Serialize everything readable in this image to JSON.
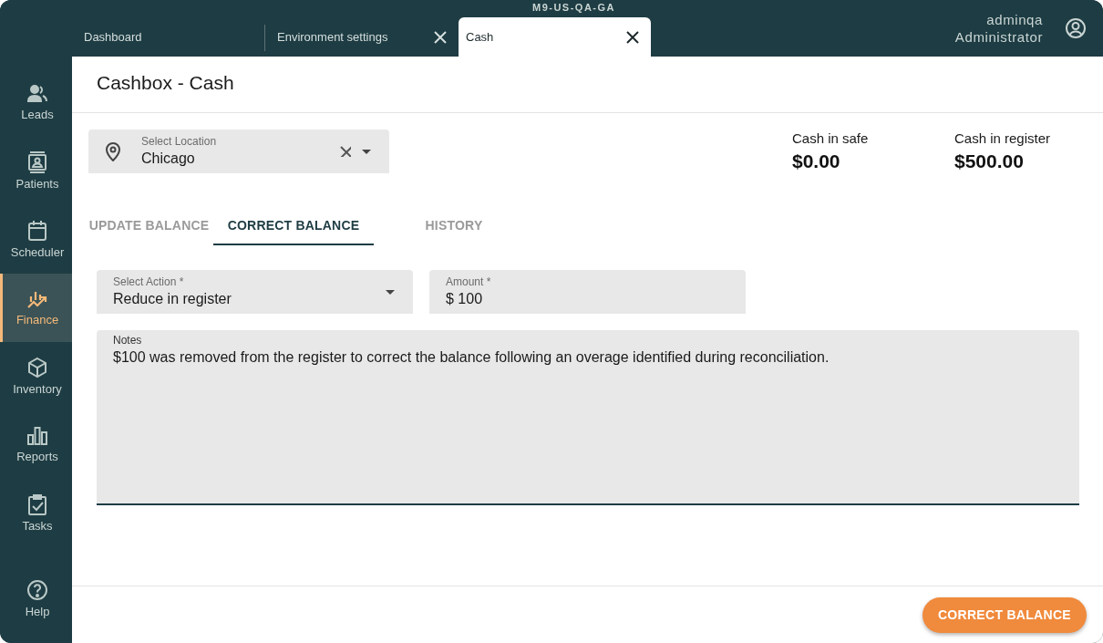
{
  "environment": "M9-US-QA-GA",
  "tabs": [
    {
      "label": "Dashboard",
      "selected": false,
      "closable": false
    },
    {
      "label": "Environment settings",
      "selected": false,
      "closable": true
    },
    {
      "label": "Cash",
      "selected": true,
      "closable": true
    }
  ],
  "user": {
    "name": "adminqa",
    "role": "Administrator"
  },
  "sidebar": {
    "items": [
      {
        "label": "Leads",
        "selected": false
      },
      {
        "label": "Patients",
        "selected": false
      },
      {
        "label": "Scheduler",
        "selected": false
      },
      {
        "label": "Finance",
        "selected": true
      },
      {
        "label": "Inventory",
        "selected": false
      },
      {
        "label": "Reports",
        "selected": false
      },
      {
        "label": "Tasks",
        "selected": false
      }
    ],
    "help": "Help"
  },
  "page_title": "Cashbox - Cash",
  "location": {
    "label": "Select Location",
    "value": "Chicago"
  },
  "balances": [
    {
      "label": "Cash in safe",
      "value": "$0.00"
    },
    {
      "label": "Cash in register",
      "value": "$500.00"
    }
  ],
  "section_tabs": [
    {
      "label": "UPDATE BALANCE",
      "selected": false
    },
    {
      "label": "CORRECT BALANCE",
      "selected": true
    },
    {
      "label": "HISTORY",
      "selected": false
    }
  ],
  "form": {
    "action": {
      "label": "Select Action *",
      "value": "Reduce in register"
    },
    "amount": {
      "label": "Amount *",
      "value": "$ 100"
    },
    "notes": {
      "label": "Notes",
      "value": "$100 was removed from the register to correct the balance following an overage identified during reconciliation."
    }
  },
  "submit": "CORRECT BALANCE"
}
